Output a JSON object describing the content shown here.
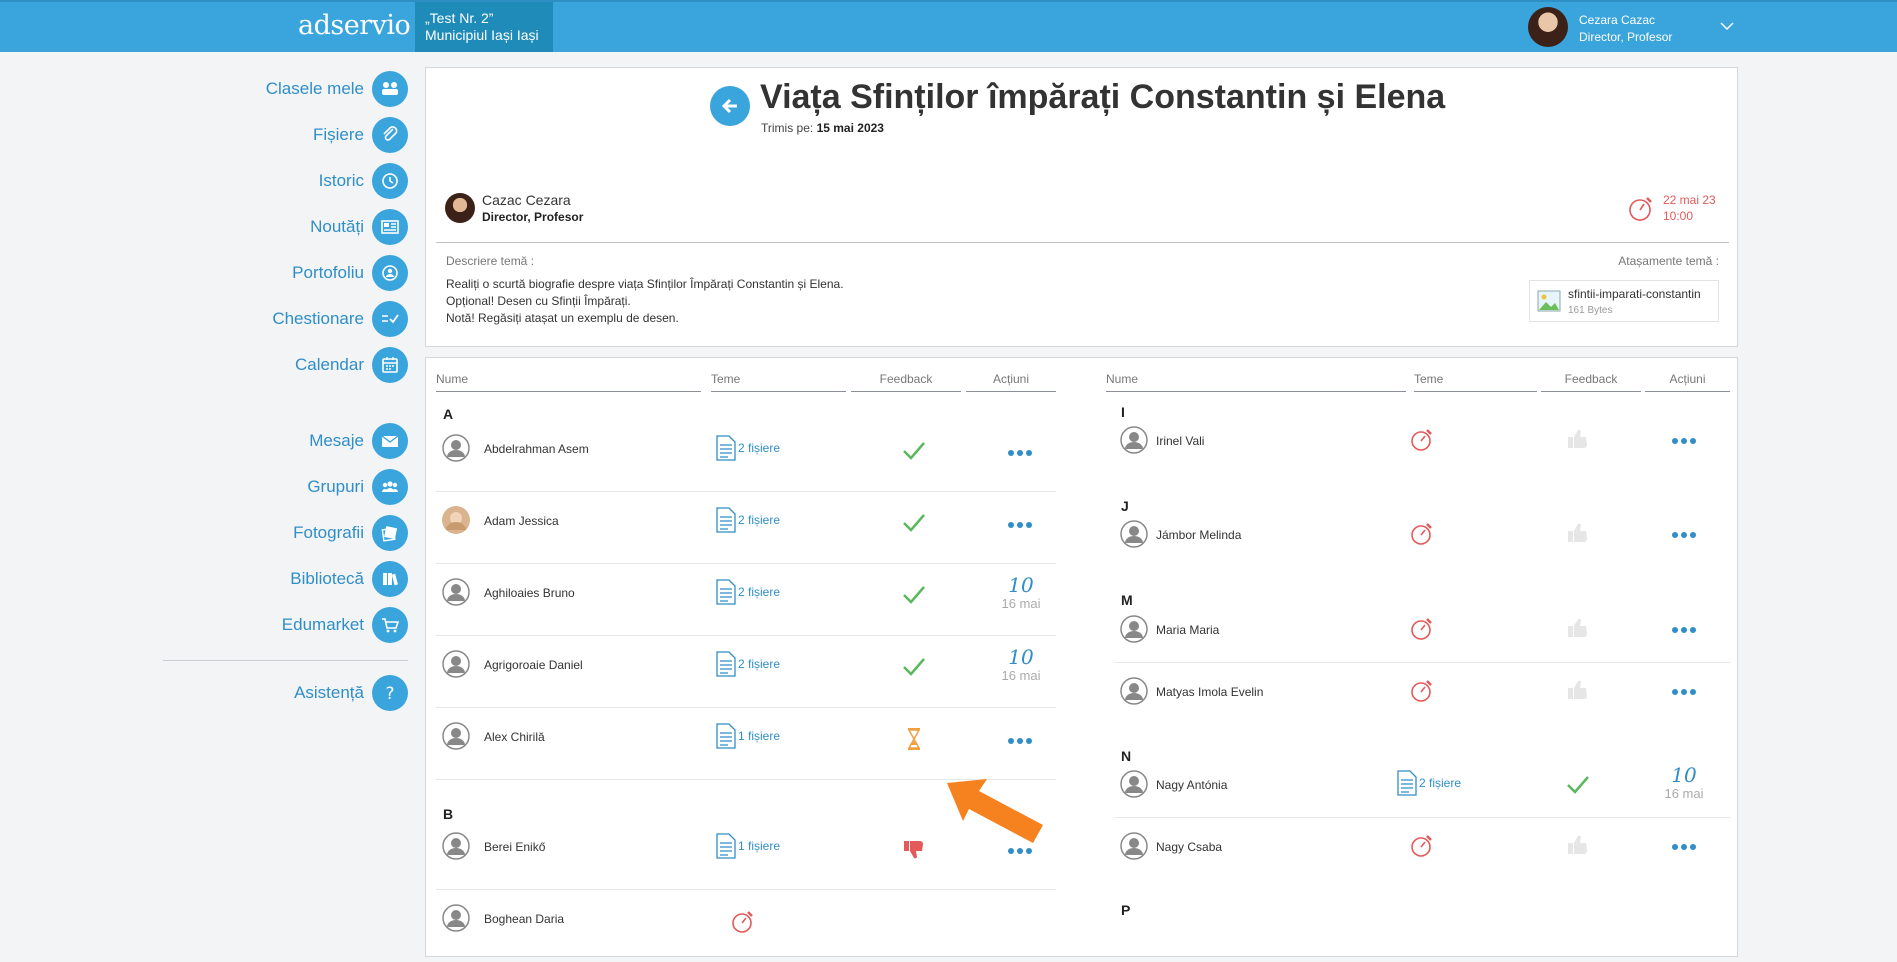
{
  "app": {
    "logo": "adservio",
    "school_line1": "„Test Nr. 2”",
    "school_line2": "Municipiul Iași Iași",
    "user_name": "Cezara Cazac",
    "user_role": "Director, Profesor"
  },
  "sidebar": {
    "items": [
      {
        "label": "Clasele mele",
        "icon": "classes-icon"
      },
      {
        "label": "Fișiere",
        "icon": "paperclip-icon"
      },
      {
        "label": "Istoric",
        "icon": "history-icon"
      },
      {
        "label": "Noutăți",
        "icon": "news-icon"
      },
      {
        "label": "Portofoliu",
        "icon": "portfolio-icon"
      },
      {
        "label": "Chestionare",
        "icon": "checklist-icon"
      },
      {
        "label": "Calendar",
        "icon": "calendar-icon"
      },
      {
        "label": "Mesaje",
        "icon": "envelope-icon"
      },
      {
        "label": "Grupuri",
        "icon": "groups-icon"
      },
      {
        "label": "Fotografii",
        "icon": "photos-icon"
      },
      {
        "label": "Bibliotecă",
        "icon": "library-icon"
      },
      {
        "label": "Edumarket",
        "icon": "cart-icon"
      },
      {
        "label": "Asistență",
        "icon": "help-icon"
      }
    ]
  },
  "homework": {
    "title": "Viața Sfinților împărați Constantin și Elena",
    "sent_label": "Trimis pe:",
    "sent_date": "15 mai 2023",
    "author_name": "Cazac Cezara",
    "author_role": "Director, Profesor",
    "deadline_date": "22 mai 23",
    "deadline_time": "10:00",
    "description_label": "Descriere temă :",
    "description_lines": [
      "Realiți o scurtă biografie despre viața Sfinților Împărați Constantin și Elena.",
      "Opțional! Desen cu Sfinții Împărați.",
      "Notă! Regăsiți atașat un exemplu de desen."
    ],
    "attachments_label": "Atașamente temă :",
    "attachment_name": "sfintii-imparati-constantin",
    "attachment_size": "161 Bytes"
  },
  "columns": {
    "name": "Nume",
    "homework": "Teme",
    "feedback": "Feedback",
    "actions": "Acțiuni"
  },
  "left_list": {
    "letters": [
      "A",
      "B"
    ],
    "students": [
      {
        "name": "Abdelrahman Asem",
        "files": "2 fișiere",
        "feedback": "check",
        "action": "more",
        "photo": false
      },
      {
        "name": "Adam Jessica",
        "files": "2 fișiere",
        "feedback": "check",
        "action": "more",
        "photo": true
      },
      {
        "name": "Aghiloaies Bruno",
        "files": "2 fișiere",
        "feedback": "check",
        "grade": "10",
        "grade_date": "16 mai",
        "photo": false
      },
      {
        "name": "Agrigoroaie Daniel",
        "files": "2 fișiere",
        "feedback": "check",
        "grade": "10",
        "grade_date": "16 mai",
        "photo": false
      },
      {
        "name": "Alex Chirilă",
        "files": "1 fișiere",
        "feedback": "pending",
        "action": "more",
        "photo": false
      },
      {
        "name": "Berei Enikő",
        "files": "1 fișiere",
        "feedback": "thumbs-down",
        "action": "more",
        "photo": false
      },
      {
        "name": "Boghean Daria",
        "files": "",
        "feedback": "none",
        "photo": false
      }
    ]
  },
  "right_list": {
    "letters": [
      "I",
      "J",
      "M",
      "N",
      "P"
    ],
    "students": [
      {
        "name": "Irinel Vali",
        "status": "overdue",
        "feedback": "thumbs-up-disabled",
        "action": "more"
      },
      {
        "name": "Jámbor Melinda",
        "status": "overdue",
        "feedback": "thumbs-up-disabled",
        "action": "more"
      },
      {
        "name": "Maria Maria",
        "status": "overdue",
        "feedback": "thumbs-up-disabled",
        "action": "more"
      },
      {
        "name": "Matyas Imola Evelin",
        "status": "overdue",
        "feedback": "thumbs-up-disabled",
        "action": "more"
      },
      {
        "name": "Nagy Antónia",
        "files": "2 fișiere",
        "feedback": "check",
        "grade": "10",
        "grade_date": "16 mai"
      },
      {
        "name": "Nagy Csaba",
        "status": "overdue",
        "feedback": "thumbs-up-disabled",
        "action": "more"
      }
    ]
  },
  "colors": {
    "brand": "#3aa4dc",
    "link": "#2f8ec8",
    "danger": "#e45959",
    "success": "#5cb85c",
    "warning": "#f0a040",
    "arrow": "#f5821f"
  }
}
